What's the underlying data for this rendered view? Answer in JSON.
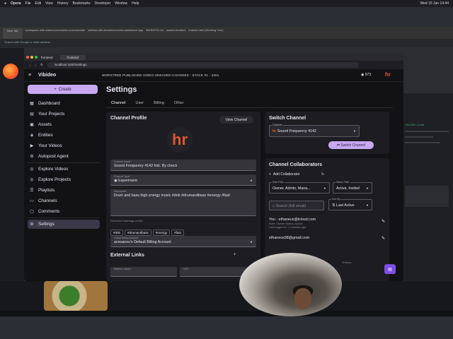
{
  "menubar": {
    "apple": "",
    "items": [
      "Opera",
      "File",
      "Edit",
      "View",
      "History",
      "Bookmarks",
      "Developer",
      "Window",
      "Help"
    ],
    "clock": "Wed 15 Jan 14:44"
  },
  "background": {
    "tab_title": "New Tab",
    "search_placeholder": "Search with Google or enter address",
    "bg_tabs": [
      "workspace-with-visited-comments-in-blockchain",
      "sidebar-with-blocked-events-assistance-app",
      "WEBSITE.md",
      "assets-frontend",
      "ADMIN-RELEASE.md",
      "indexer.html (Working Tree)"
    ],
    "stats": [
      "+14,219 -1,144"
    ]
  },
  "app": {
    "tab_label": "frontend",
    "url": "localhost:4200/settings",
    "logo": "Vibideo",
    "banner": "WORKTREE PUBLISHED-VIDEO-UNSAVED-CHANGES - STACK #1 - 4201",
    "credits": "973",
    "avatar_text": "hr",
    "sidebar": {
      "create_label": "Create",
      "items": [
        {
          "label": "Dashboard",
          "icon": "dashboard-icon"
        },
        {
          "label": "Your Projects",
          "icon": "folder-icon"
        },
        {
          "label": "Assets",
          "icon": "assets-icon"
        },
        {
          "label": "Entities",
          "icon": "entities-icon"
        },
        {
          "label": "Your Videos",
          "icon": "video-icon"
        },
        {
          "label": "Autopost Agent",
          "icon": "agent-icon"
        },
        {
          "label": "Explore Videos",
          "icon": "explore-icon"
        },
        {
          "label": "Explore Projects",
          "icon": "explore-projects-icon"
        },
        {
          "label": "Playlists",
          "icon": "playlist-icon"
        },
        {
          "label": "Channels",
          "icon": "channels-icon"
        },
        {
          "label": "Comments",
          "icon": "comment-icon"
        },
        {
          "label": "Settings",
          "icon": "gear-icon"
        }
      ]
    },
    "settings": {
      "title": "Settings",
      "tabs": [
        "Channel",
        "User",
        "Billing",
        "Other"
      ],
      "channel_profile": {
        "heading": "Channel Profile",
        "view_channel": "View Channel",
        "logo_text": "hr",
        "name_label": "Channel Name*",
        "name_value": "Sound Frequency 4142 hist. By check",
        "type_label": "Channel Type*",
        "type_value": "Experiment",
        "desc_label": "Description",
        "desc_value": "Drum and bass high energy music #dnb #drumandbass #energy #fast",
        "hashtags_label": "Detected Hashtags (4/30)",
        "hashtags": [
          "#dnb",
          "#drumandbass",
          "#energy",
          "#fast"
        ],
        "billing_label": "Linked Billing Account",
        "billing_value": "aceuaceu's Default Billing Account"
      },
      "external_links": {
        "heading": "External Links",
        "platform_label": "Platform Name*",
        "url_label": "URL*"
      },
      "switch_channel": {
        "heading": "Switch Channel",
        "label": "Channel",
        "value": "Sound Frequency 4142",
        "button": "Switch Channel"
      },
      "collaborators": {
        "heading": "Channel Collaborators",
        "add": "Add Collaborator",
        "role_filter_label": "Role Filter",
        "role_filter_value": "Owner, Admin, Mana...",
        "status_filter_label": "Status Filter",
        "status_filter_value": "Active, Invited",
        "search_placeholder": "Search (full email)",
        "sort_label": "Sort By",
        "sort_value": "Last Active",
        "people": [
          {
            "email": "You · ethaneus@icloud.com",
            "meta1": "Role: Owner   Status: Active",
            "meta2": "Last logged in: 1 minutes ago"
          },
          {
            "email": "ethaneus98@gmail.com",
            "meta1": "",
            "meta2": ""
          }
        ],
        "footer": "Editors"
      }
    }
  }
}
